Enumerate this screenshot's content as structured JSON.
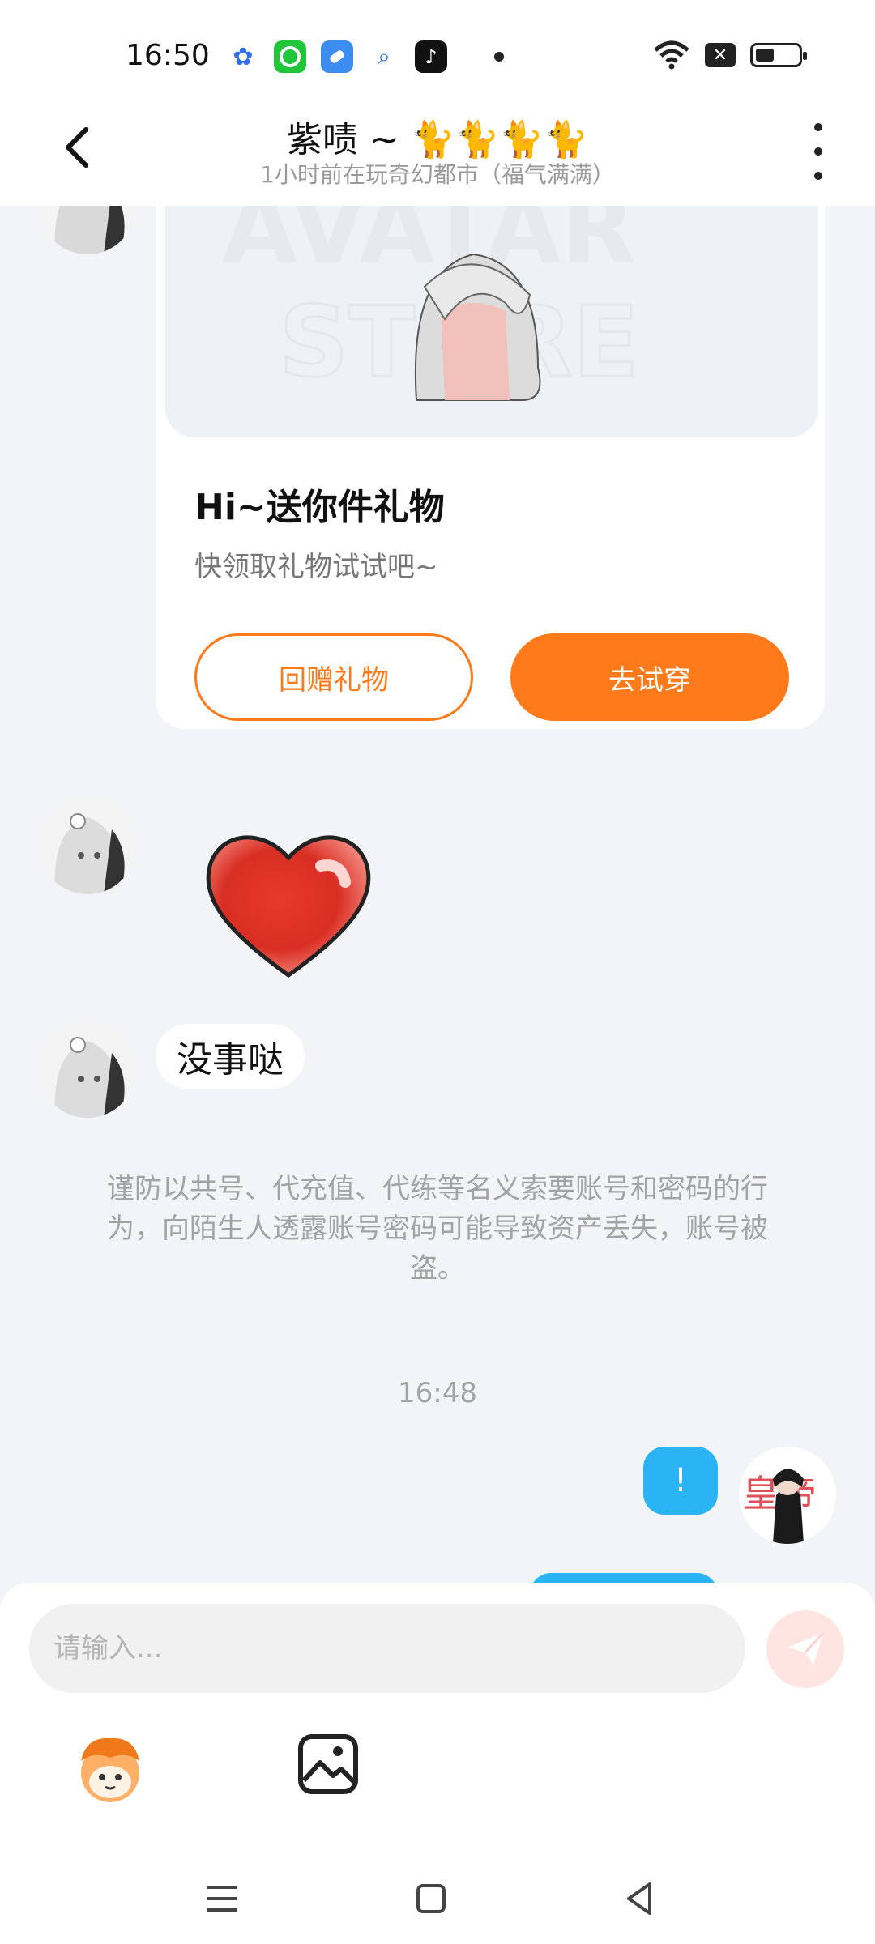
{
  "status": {
    "time": "16:50"
  },
  "header": {
    "title": "紫啧 ~ 🐈🐈🐈🐈",
    "subtitle": "1小时前在玩奇幻都市（福气满满）"
  },
  "gift_card": {
    "image_watermark": "AVATAR STORE",
    "title": "Hi~送你件礼物",
    "subtitle": "快领取礼物试试吧~",
    "return_gift_label": "回赠礼物",
    "try_on_label": "去试穿"
  },
  "messages": {
    "text_bubble": "没事哒",
    "notice": "谨防以共号、代充值、代练等名义索要账号和密码的行为，向陌生人透露账号密码可能导致资产丢失，账号被盗。",
    "time_separator": "16:48",
    "my_message": "!"
  },
  "input": {
    "placeholder": "请输入..."
  },
  "colors": {
    "accent": "#ff7a1a",
    "my_bubble": "#2ab3f5",
    "background": "#f2f4f7"
  }
}
